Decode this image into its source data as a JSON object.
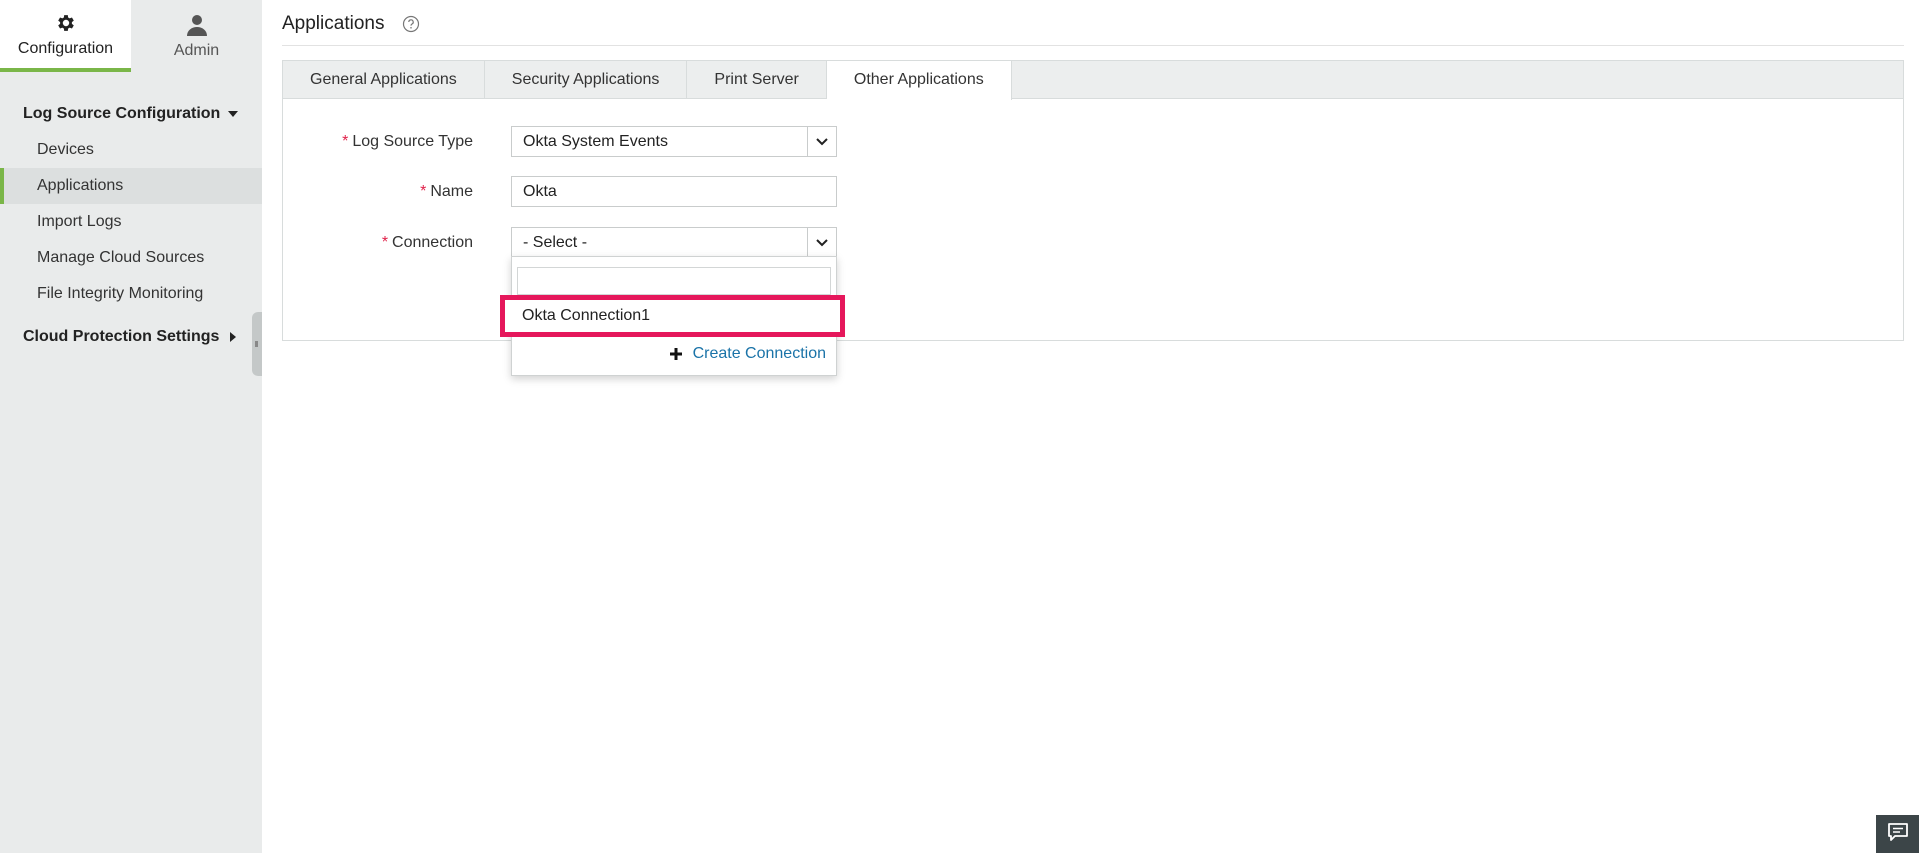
{
  "topnav": {
    "configuration_label": "Configuration",
    "configuration_icon": "gear-icon",
    "admin_label": "Admin",
    "admin_icon": "user-icon"
  },
  "sidebar": {
    "section1_title": "Log Source Configuration",
    "items": [
      {
        "label": "Devices"
      },
      {
        "label": "Applications",
        "active": true
      },
      {
        "label": "Import Logs"
      },
      {
        "label": "Manage Cloud Sources"
      },
      {
        "label": "File Integrity Monitoring"
      }
    ],
    "section2_title": "Cloud Protection Settings"
  },
  "header": {
    "title": "Applications",
    "help_icon": "help-circle-icon"
  },
  "tabs": [
    {
      "label": "General Applications"
    },
    {
      "label": "Security Applications"
    },
    {
      "label": "Print Server"
    },
    {
      "label": "Other Applications",
      "active": true
    }
  ],
  "form": {
    "required_mark": "*",
    "log_source_type": {
      "label": "Log Source Type",
      "value": "Okta System Events"
    },
    "name": {
      "label": "Name",
      "value": "Okta"
    },
    "connection": {
      "label": "Connection",
      "value": "- Select -"
    }
  },
  "dropdown": {
    "search_value": "",
    "options": [
      {
        "label": "Okta Connection1"
      }
    ],
    "create_label": "Create Connection"
  },
  "colors": {
    "accent_green": "#7ab648",
    "highlight_pink": "#e5175b",
    "link_blue": "#1a73a8",
    "required_red": "#e0224a"
  }
}
